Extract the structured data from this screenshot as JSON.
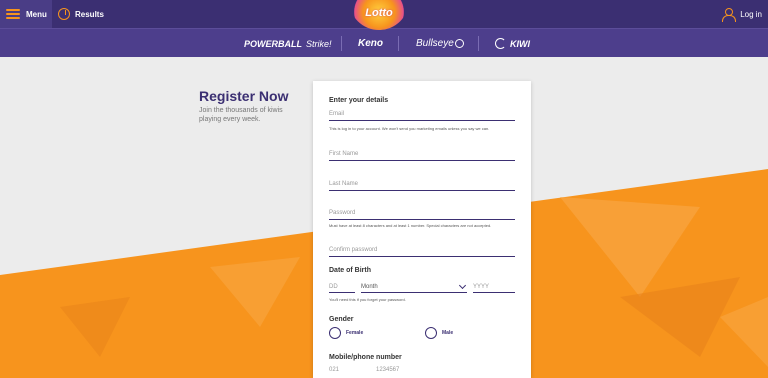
{
  "topbar": {
    "menu_label": "Menu",
    "results_label": "Results",
    "login_label": "Log in",
    "logo_text": "Lotto"
  },
  "games": {
    "powerball": "POWERBALL",
    "strike": "Strike!",
    "keno": "Keno",
    "bullseye": "Bullseye",
    "kiwi": "KIWI"
  },
  "intro": {
    "title": "Register Now",
    "subtitle": "Join the thousands of kiwis playing every week."
  },
  "form": {
    "details_title": "Enter your details",
    "email_placeholder": "Email",
    "email_hint": "This is log in to your account. We won't send you marketing emails unless you say we can.",
    "first_name_placeholder": "First Name",
    "last_name_placeholder": "Last Name",
    "password_placeholder": "Password",
    "password_hint": "Must have at least 8 characters and at least 1 number. Special characters are not accepted.",
    "confirm_placeholder": "Confirm password",
    "dob_title": "Date of Birth",
    "dd_placeholder": "DD",
    "month_value": "Month",
    "yyyy_placeholder": "YYYY",
    "dob_hint": "You'll need this if you forget your password.",
    "gender_title": "Gender",
    "female_label": "Female",
    "male_label": "Male",
    "phone_title": "Mobile/phone number",
    "area_placeholder": "021",
    "number_placeholder": "1234567"
  },
  "colors": {
    "primary_purple": "#3b2f72",
    "accent_orange": "#f7941d"
  }
}
